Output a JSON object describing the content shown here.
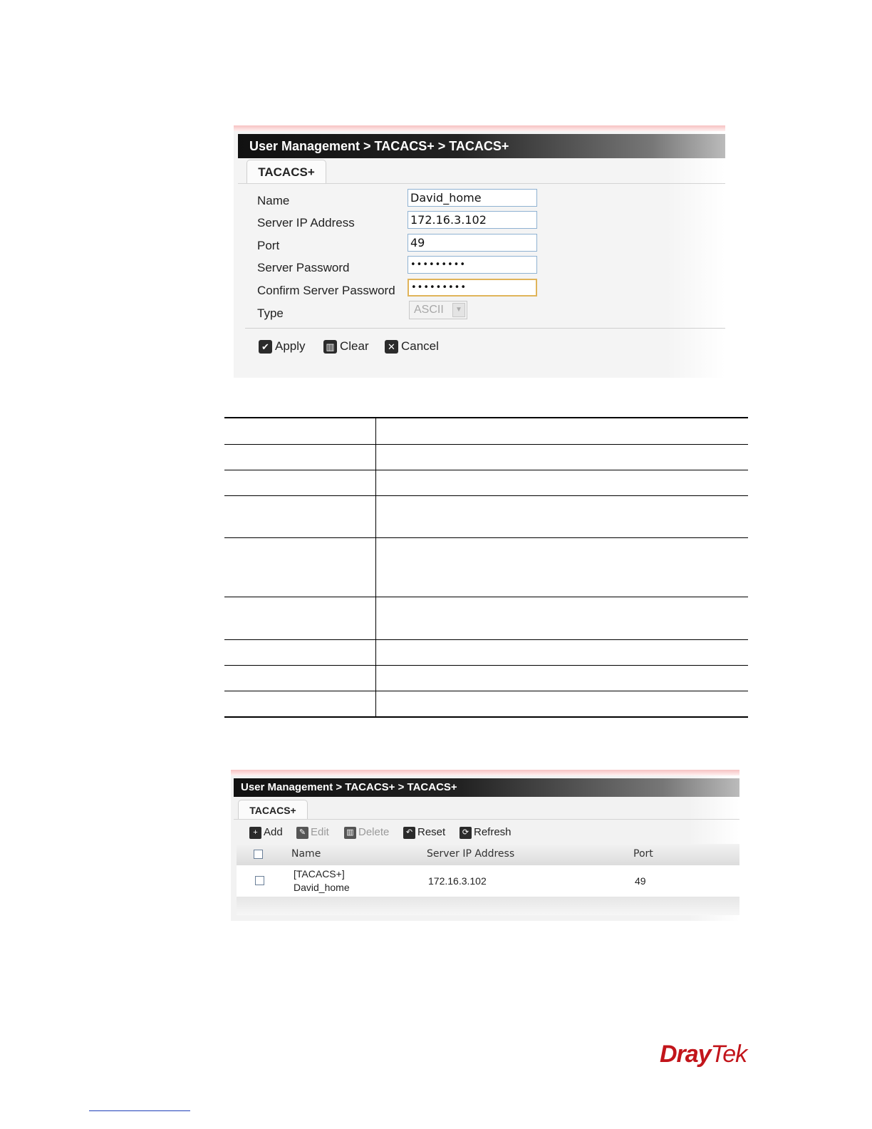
{
  "form_panel": {
    "title": "User Management > TACACS+ > TACACS+",
    "tab": "TACACS+",
    "fields": [
      {
        "label": "Name",
        "value": "David_home"
      },
      {
        "label": "Server IP Address",
        "value": "172.16.3.102"
      },
      {
        "label": "Port",
        "value": "49"
      },
      {
        "label": "Server Password",
        "value": "•••••••••"
      },
      {
        "label": "Confirm Server Password",
        "value": "•••••••••"
      }
    ],
    "type_label": "Type",
    "type_value": "ASCII",
    "buttons": {
      "apply": "Apply",
      "clear": "Clear",
      "cancel": "Cancel"
    }
  },
  "list_panel": {
    "title": "User Management > TACACS+ > TACACS+",
    "tab": "TACACS+",
    "toolbar": {
      "add": "Add",
      "edit": "Edit",
      "delete": "Delete",
      "reset": "Reset",
      "refresh": "Refresh"
    },
    "columns": [
      "Name",
      "Server IP Address",
      "Port"
    ],
    "rows": [
      {
        "name_line1": "[TACACS+]",
        "name_line2": "David_home",
        "ip": "172.16.3.102",
        "port": "49"
      }
    ]
  },
  "logo": {
    "dray": "Dray",
    "tek": "Tek"
  },
  "colors": {
    "brand": "#c2151b",
    "focus_border": "#e0b45a",
    "input_border": "#8fb2d2"
  }
}
